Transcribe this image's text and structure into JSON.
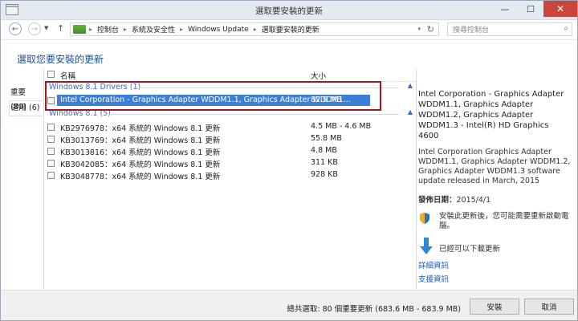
{
  "window": {
    "title": "選取要安裝的更新",
    "min_glyph": "—",
    "max_glyph": "☐",
    "close_glyph": "✕"
  },
  "nav": {
    "back_glyph": "←",
    "forward_glyph": "→",
    "dropdown_glyph": "▼",
    "up_glyph": "↑",
    "breadcrumb": [
      "控制台",
      "系統及安全性",
      "Windows Update",
      "選取要安裝的更新"
    ],
    "separator": "▸",
    "address_dropdown_glyph": "▾",
    "refresh_glyph": "↻",
    "search_placeholder": "搜尋控制台",
    "search_glyph": "⌕"
  },
  "heading": "選取您要安裝的更新",
  "categories": [
    {
      "label": "重要 (80)"
    },
    {
      "label": "選用 (6)"
    }
  ],
  "columns": {
    "name": "名稱",
    "size": "大小"
  },
  "groups": [
    {
      "label": "Windows 8.1 Drivers (1)",
      "collapse_glyph": "▲",
      "rows": [
        {
          "name": "Intel Corporation - Graphics Adapter WDDM1.1, Graphics Adapter WDDM1...",
          "size": "82.9 MB"
        }
      ]
    },
    {
      "label": "Windows 8.1 (5)",
      "collapse_glyph": "▲",
      "rows": [
        {
          "name": "KB2976978：x64 系統的 Windows 8.1 更新",
          "size": "4.5 MB - 4.6 MB"
        },
        {
          "name": "KB3013769：x64 系統的 Windows 8.1 更新",
          "size": "55.8 MB"
        },
        {
          "name": "KB3013816：x64 系統的 Windows 8.1 更新",
          "size": "4.8 MB"
        },
        {
          "name": "KB3042085：x64 系統的 Windows 8.1 更新",
          "size": "311 KB"
        },
        {
          "name": "KB3048778：x64 系統的 Windows 8.1 更新",
          "size": "928 KB"
        }
      ]
    }
  ],
  "details": {
    "title": "Intel Corporation - Graphics Adapter WDDM1.1, Graphics Adapter WDDM1.2, Graphics Adapter WDDM1.3 - Intel(R) HD Graphics 4600",
    "description": "Intel Corporation Graphics Adapter WDDM1.1, Graphics Adapter WDDM1.2, Graphics Adapter WDDM1.3 software update released in March, 2015",
    "date_label": "發佈日期：",
    "date_value": "2015/4/1",
    "restart_note": "安裝此更新後，您可能需要重新啟動電腦。",
    "download_note": "已經可以下載更新",
    "more_info": "詳細資訊",
    "support_info": "支援資訊"
  },
  "footer": {
    "total": "總共選取: 80 個重要更新 (683.6 MB - 683.9 MB)",
    "install": "安裝",
    "cancel": "取消"
  },
  "colors": {
    "accent": "#1e4f96",
    "selection": "#3b80d6",
    "highlight_box": "#a01920",
    "close_button": "#c9463d"
  }
}
